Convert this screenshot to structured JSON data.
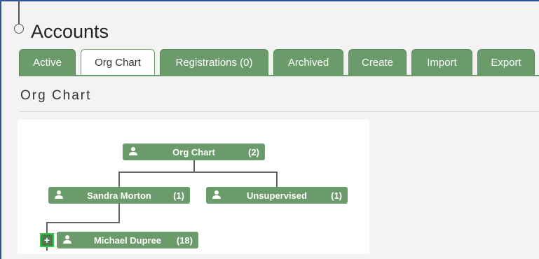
{
  "page": {
    "title": "Accounts"
  },
  "tabs": [
    {
      "label": "Active"
    },
    {
      "label": "Org Chart"
    },
    {
      "label": "Registrations (0)"
    },
    {
      "label": "Archived"
    },
    {
      "label": "Create"
    },
    {
      "label": "Import"
    },
    {
      "label": "Export"
    }
  ],
  "section": {
    "title": "Org Chart"
  },
  "org_chart": {
    "root": {
      "name": "Org Chart",
      "count": "(2)"
    },
    "children": [
      {
        "name": "Sandra Morton",
        "count": "(1)"
      },
      {
        "name": "Unsupervised",
        "count": "(1)"
      }
    ],
    "grandchild": {
      "name": "Michael Dupree",
      "count": "(18)",
      "expand_symbol": "+"
    }
  },
  "colors": {
    "accent": "#6b9a6b",
    "frame_border": "#2f5597",
    "highlight": "#2ecc40"
  }
}
